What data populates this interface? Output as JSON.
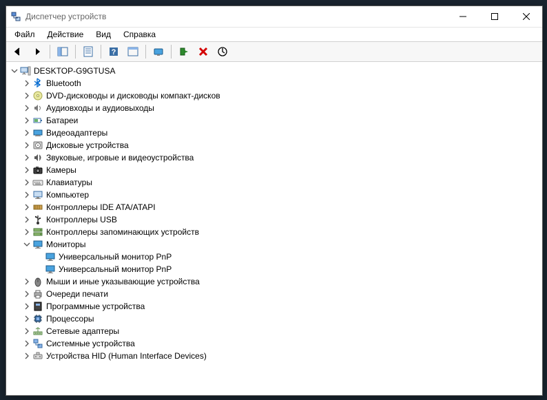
{
  "window": {
    "title": "Диспетчер устройств"
  },
  "menu": {
    "file": "Файл",
    "action": "Действие",
    "view": "Вид",
    "help": "Справка"
  },
  "tree": {
    "root": {
      "label": "DESKTOP-G9GTUSA",
      "expanded": true
    },
    "categories": [
      {
        "label": "Bluetooth",
        "icon": "bluetooth",
        "expanded": false
      },
      {
        "label": "DVD-дисководы и дисководы компакт-дисков",
        "icon": "disc",
        "expanded": false
      },
      {
        "label": "Аудиовходы и аудиовыходы",
        "icon": "audio",
        "expanded": false
      },
      {
        "label": "Батареи",
        "icon": "battery",
        "expanded": false
      },
      {
        "label": "Видеоадаптеры",
        "icon": "display-adapter",
        "expanded": false
      },
      {
        "label": "Дисковые устройства",
        "icon": "disk-drive",
        "expanded": false
      },
      {
        "label": "Звуковые, игровые и видеоустройства",
        "icon": "sound",
        "expanded": false
      },
      {
        "label": "Камеры",
        "icon": "camera",
        "expanded": false
      },
      {
        "label": "Клавиатуры",
        "icon": "keyboard",
        "expanded": false
      },
      {
        "label": "Компьютер",
        "icon": "computer",
        "expanded": false
      },
      {
        "label": "Контроллеры IDE ATA/ATAPI",
        "icon": "ide",
        "expanded": false
      },
      {
        "label": "Контроллеры USB",
        "icon": "usb",
        "expanded": false
      },
      {
        "label": "Контроллеры запоминающих устройств",
        "icon": "storage-ctrl",
        "expanded": false
      },
      {
        "label": "Мониторы",
        "icon": "monitor",
        "expanded": true,
        "children": [
          {
            "label": "Универсальный монитор PnP",
            "icon": "monitor"
          },
          {
            "label": "Универсальный монитор PnP",
            "icon": "monitor"
          }
        ]
      },
      {
        "label": "Мыши и иные указывающие устройства",
        "icon": "mouse",
        "expanded": false
      },
      {
        "label": "Очереди печати",
        "icon": "printer",
        "expanded": false
      },
      {
        "label": "Программные устройства",
        "icon": "software",
        "expanded": false
      },
      {
        "label": "Процессоры",
        "icon": "cpu",
        "expanded": false
      },
      {
        "label": "Сетевые адаптеры",
        "icon": "network",
        "expanded": false
      },
      {
        "label": "Системные устройства",
        "icon": "system",
        "expanded": false
      },
      {
        "label": "Устройства HID (Human Interface Devices)",
        "icon": "hid",
        "expanded": false
      }
    ]
  }
}
